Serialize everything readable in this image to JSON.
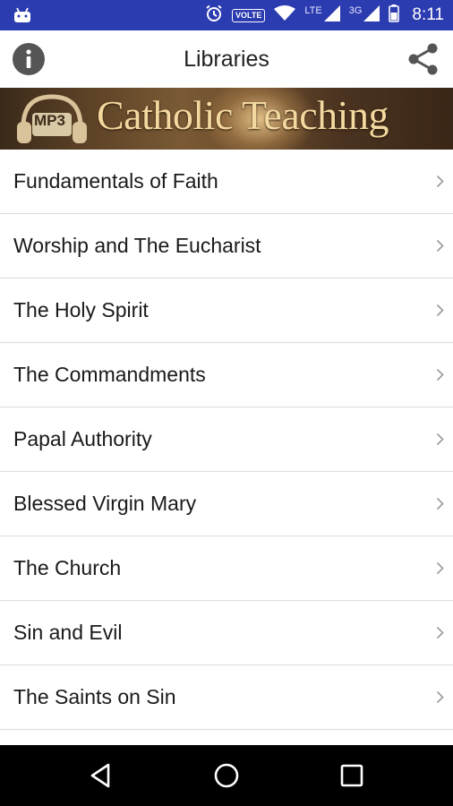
{
  "status_bar": {
    "time": "8:11",
    "volte": "VOLTE",
    "lte": "LTE",
    "network": "3G",
    "icons": [
      "android-notification-icon",
      "alarm-icon",
      "wifi-icon",
      "signal-icon",
      "battery-icon"
    ]
  },
  "app_bar": {
    "title": "Libraries",
    "left_icon": "info-icon",
    "right_icon": "share-icon"
  },
  "banner": {
    "title": "Catholic Teaching",
    "badge": "MP3"
  },
  "libraries": [
    {
      "label": "Fundamentals of Faith"
    },
    {
      "label": "Worship and The Eucharist"
    },
    {
      "label": "The Holy Spirit"
    },
    {
      "label": "The Commandments"
    },
    {
      "label": "Papal Authority"
    },
    {
      "label": "Blessed Virgin Mary"
    },
    {
      "label": "The Church"
    },
    {
      "label": "Sin and Evil"
    },
    {
      "label": "The Saints on Sin"
    }
  ],
  "nav_bar": {
    "icons": [
      "back-icon",
      "home-icon",
      "recents-icon"
    ]
  },
  "colors": {
    "status_bar": "#2b3bb0",
    "banner_text": "#f3d9a0",
    "divider": "#dcdcdc",
    "icon_gray": "#555555"
  }
}
